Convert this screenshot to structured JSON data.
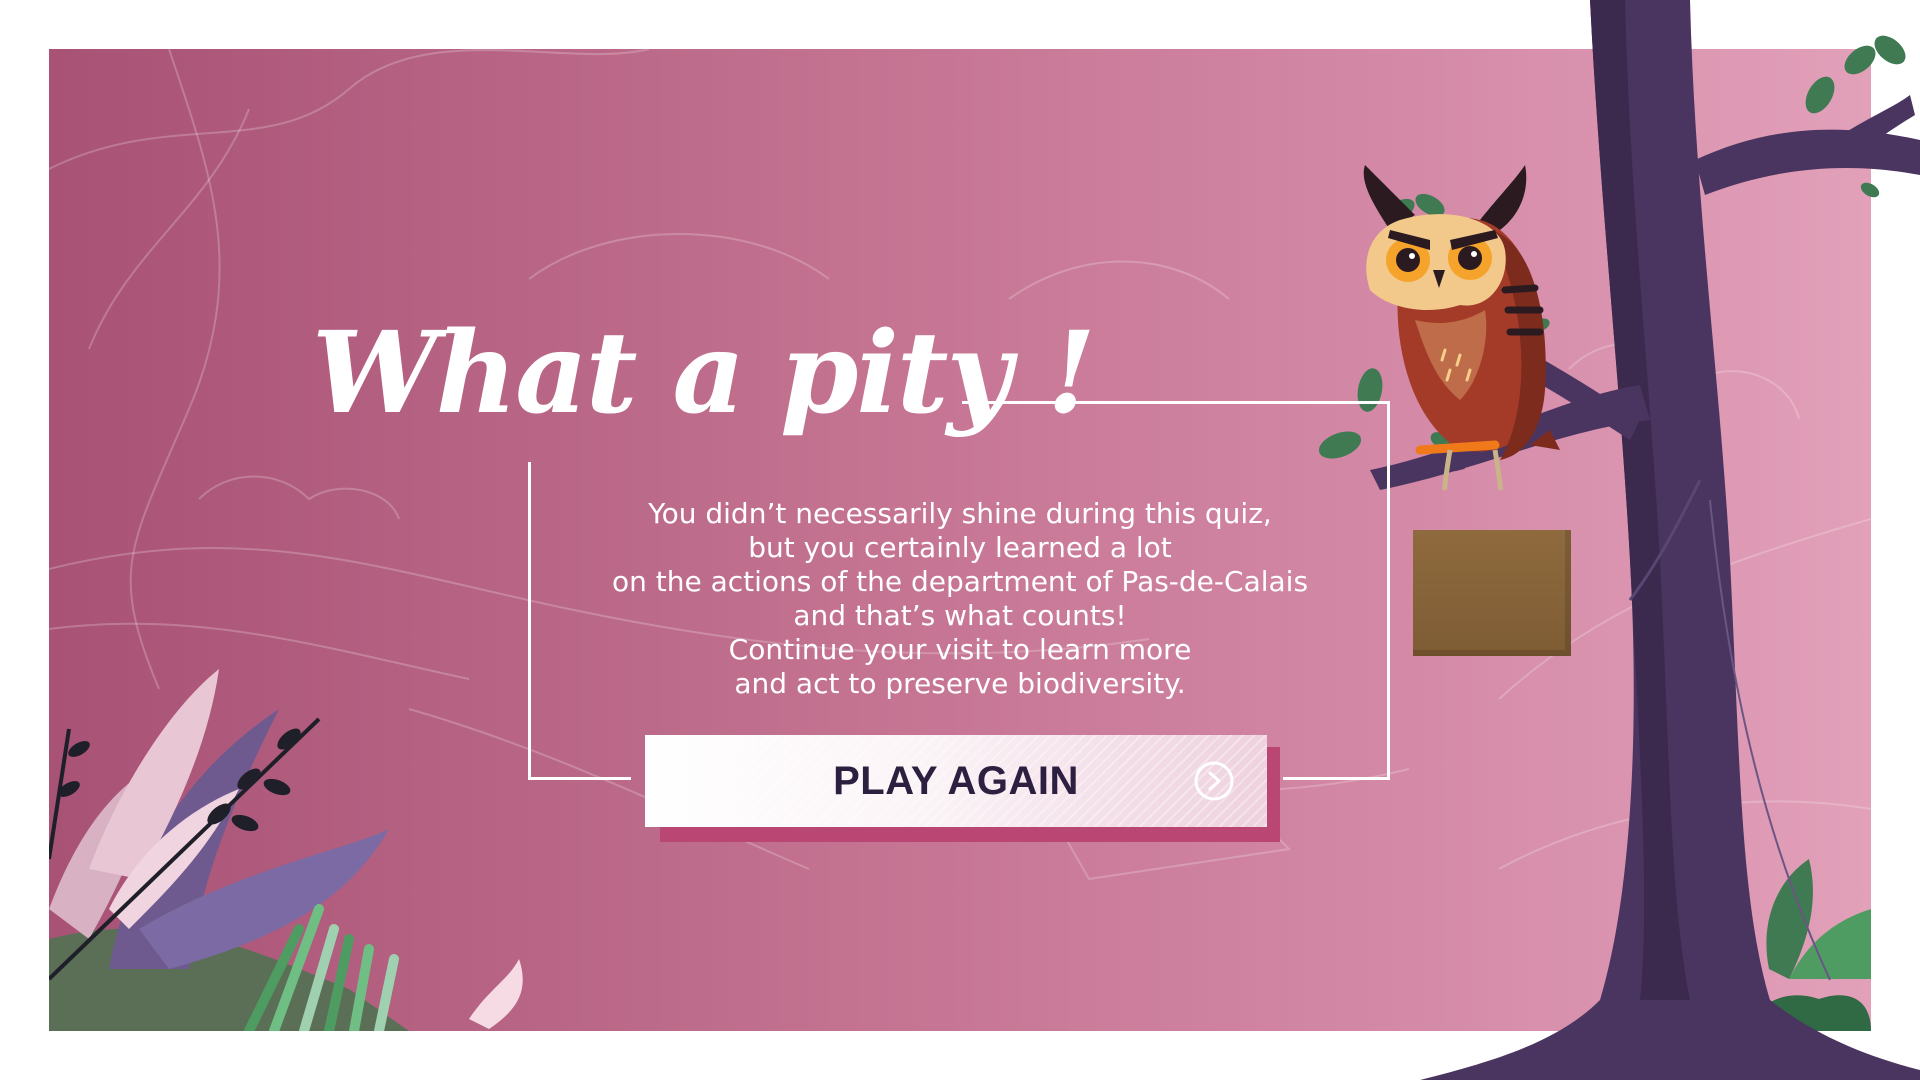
{
  "screen": {
    "title": "What a pity !",
    "message_lines": [
      "You didn’t necessarily shine during this quiz,",
      "but you certainly learned a lot",
      "on the actions of the department of Pas-de-Calais",
      "and that’s what counts!",
      "Continue your visit to learn more",
      "and act to preserve biodiversity."
    ],
    "play_again_label": "PLAY AGAIN",
    "play_again_icon": "arrow-circle-right-icon"
  },
  "theme": {
    "background_left": "#a85275",
    "background_right": "#e2a0b9",
    "button_text": "#2d1f3f",
    "button_shadow": "#b94673",
    "tree": "#4a3560",
    "owl_body": "#a33b28",
    "leaf": "#3f7a52"
  }
}
